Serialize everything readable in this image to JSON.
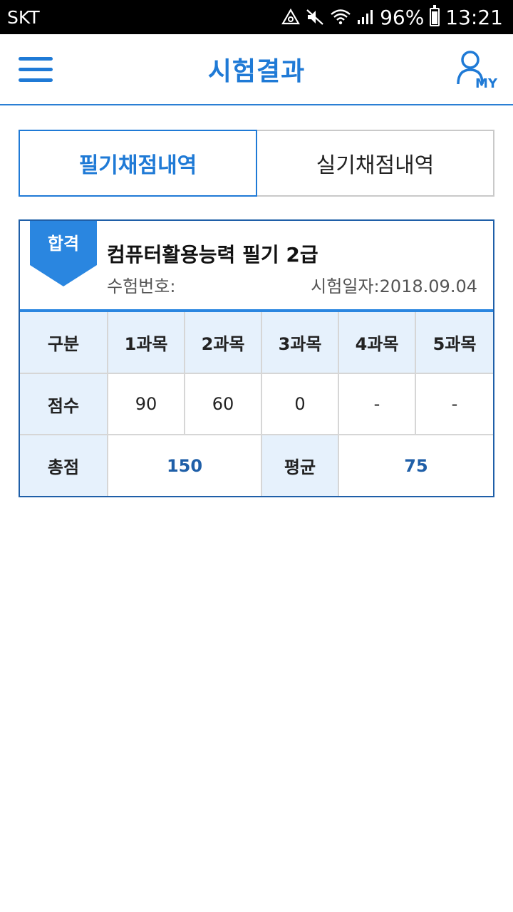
{
  "status_bar": {
    "carrier": "SKT",
    "battery": "96%",
    "time": "13:21"
  },
  "header": {
    "title": "시험결과",
    "my_label": "MY"
  },
  "tabs": [
    {
      "label": "필기채점내역",
      "active": true
    },
    {
      "label": "실기채점내역",
      "active": false
    }
  ],
  "result": {
    "badge": "합격",
    "exam_name": "컴퓨터활용능력 필기 2급",
    "exam_number_label": "수험번호:",
    "exam_date_label": "시험일자:2018.09.04",
    "table": {
      "header_label": "구분",
      "subjects": [
        "1과목",
        "2과목",
        "3과목",
        "4과목",
        "5과목"
      ],
      "score_label": "점수",
      "scores": [
        "90",
        "60",
        "0",
        "-",
        "-"
      ],
      "total_label": "총점",
      "total": "150",
      "average_label": "평균",
      "average": "75"
    }
  },
  "colors": {
    "accent": "#1f7ad6",
    "header_cell_bg": "#e6f1fc",
    "value_blue": "#1f5fa8"
  }
}
